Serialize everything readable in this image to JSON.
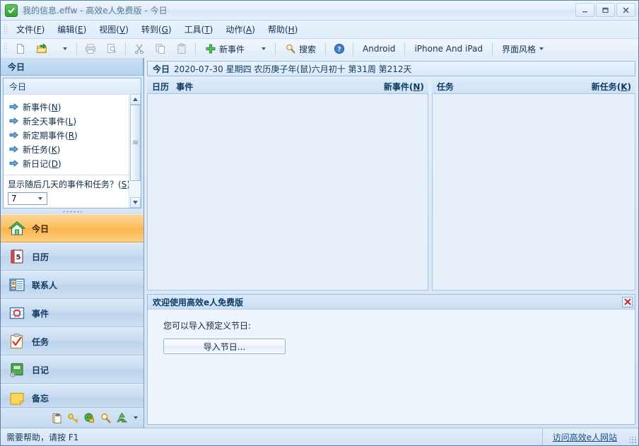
{
  "window": {
    "icon": "green-check-circle-icon",
    "title": "我的信息.effw - 高效e人免费版 - 今日",
    "minimize_label": "–",
    "maximize_label": "□",
    "close_label": "✕"
  },
  "menubar": {
    "items": [
      {
        "text": "文件",
        "mnemonic": "F"
      },
      {
        "text": "编辑",
        "mnemonic": "E"
      },
      {
        "text": "视图",
        "mnemonic": "V"
      },
      {
        "text": "转到",
        "mnemonic": "G"
      },
      {
        "text": "工具",
        "mnemonic": "T"
      },
      {
        "text": "动作",
        "mnemonic": "A"
      },
      {
        "text": "帮助",
        "mnemonic": "H"
      }
    ]
  },
  "toolbar": {
    "new_file_icon": "new-document-icon",
    "open_icon": "open-folder-icon",
    "print_icon": "printer-icon",
    "print_preview_icon": "print-preview-icon",
    "cut_icon": "scissors-icon",
    "copy_icon": "copy-icon",
    "paste_icon": "paste-icon",
    "new_event_icon": "plus-icon",
    "new_event_label": "新事件",
    "search_icon": "magnifier-icon",
    "search_label": "搜索",
    "help_icon": "help-circle-icon",
    "android_label": "Android",
    "iphone_label": "iPhone And iPad",
    "skin_label": "界面风格"
  },
  "navpane": {
    "header": "今日",
    "upper_title": "今日",
    "tasks": [
      {
        "text": "新事件",
        "mnemonic": "N"
      },
      {
        "text": "新全天事件",
        "mnemonic": "L"
      },
      {
        "text": "新定期事件",
        "mnemonic": "R"
      },
      {
        "text": "新任务",
        "mnemonic": "K"
      },
      {
        "text": "新日记",
        "mnemonic": "D"
      }
    ],
    "spinner_label": "显示随后几天的事件和任务？",
    "spinner_mnemonic": "S",
    "spinner_value": "7",
    "buttons": [
      {
        "label": "今日",
        "icon": "house-icon",
        "active": true
      },
      {
        "label": "日历",
        "icon": "calendar-icon",
        "active": false
      },
      {
        "label": "联系人",
        "icon": "contacts-icon",
        "active": false
      },
      {
        "label": "事件",
        "icon": "event-grid-icon",
        "active": false
      },
      {
        "label": "任务",
        "icon": "clipboard-check-icon",
        "active": false
      },
      {
        "label": "日记",
        "icon": "journal-icon",
        "active": false
      },
      {
        "label": "备忘",
        "icon": "sticky-note-icon",
        "active": false
      }
    ],
    "footer_icons": [
      "notes-icon",
      "key-icon",
      "globe-lock-icon",
      "magnifier-icon",
      "recycle-icon",
      "chevron-down-icon"
    ]
  },
  "daybar": {
    "today_label": "今日",
    "detail": "2020-07-30 星期四 农历庚子年(鼠)六月初十  第31周 第212天",
    "date": "2020-07-30",
    "weekday": "星期四",
    "lunar": "农历庚子年(鼠)六月初十",
    "week_of_year": "第31周",
    "day_of_year": "第212天"
  },
  "panes": {
    "calendar": {
      "title_a": "日历",
      "title_b": "事件",
      "action": "新事件",
      "action_mnemonic": "N",
      "items": []
    },
    "tasks": {
      "title": "任务",
      "action": "新任务",
      "action_mnemonic": "K",
      "items": []
    }
  },
  "welcome": {
    "title": "欢迎使用高效e人免费版",
    "close_icon": "red-x-icon",
    "text": "您可以导入预定义节日:",
    "button_label": "导入节日..."
  },
  "statusbar": {
    "hint": "需要帮助，请按 F1",
    "link": "访问高效e人网站"
  },
  "colors": {
    "accent": "#1b4f8a",
    "active_nav": "#fcb34a",
    "panel_border": "#95bada",
    "header_text": "#0d3b66"
  }
}
